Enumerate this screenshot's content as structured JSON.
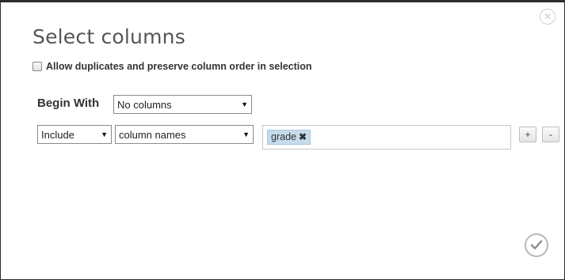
{
  "dialog": {
    "title": "Select columns",
    "close_icon": "close-icon",
    "confirm_icon": "checkmark-icon"
  },
  "options": {
    "allow_duplicates_label": "Allow duplicates and preserve column order in selection",
    "allow_duplicates_checked": false
  },
  "begin_with": {
    "label": "Begin With",
    "value": "No columns"
  },
  "rule": {
    "mode_value": "Include",
    "type_value": "column names",
    "tags": [
      {
        "label": "grade",
        "remove_icon": "remove-x-icon"
      }
    ],
    "add_label": "+",
    "remove_label": "-"
  },
  "colors": {
    "tag_background": "#c5dceb",
    "dialog_background": "#ffffff",
    "backdrop": "#2b2b2b"
  }
}
